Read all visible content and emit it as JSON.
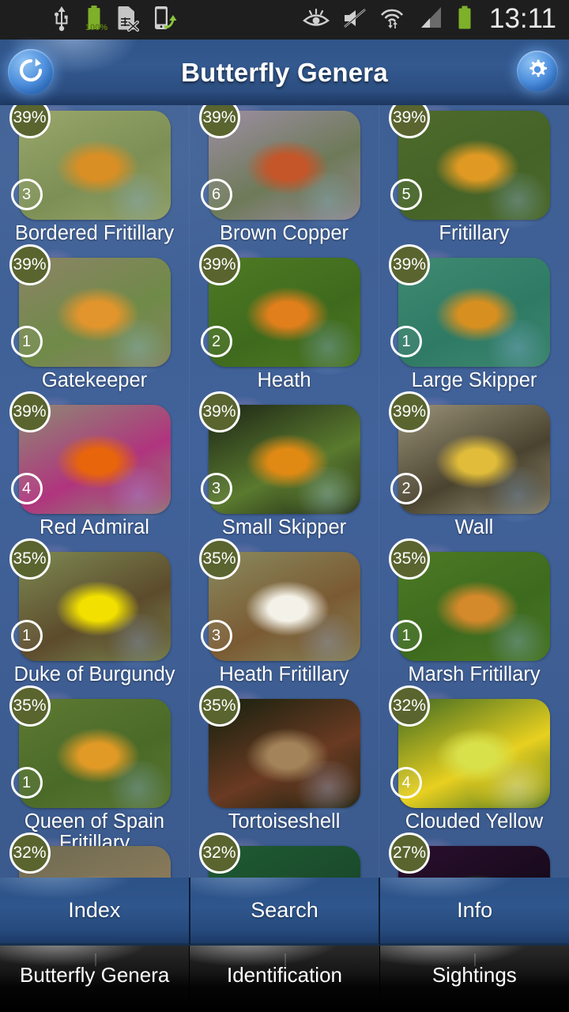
{
  "status_bar": {
    "time": "13:11",
    "battery_percent": "100%",
    "icons": [
      "usb-icon",
      "battery-icon",
      "sim-card-disabled-icon",
      "phone-transfer-icon",
      "eye-care-icon",
      "mute-icon",
      "wifi-icon",
      "signal-icon",
      "battery-icon"
    ]
  },
  "title_bar": {
    "title": "Butterfly Genera",
    "refresh_label": "refresh-icon",
    "settings_label": "gear-icon"
  },
  "grid": {
    "items": [
      {
        "name": "Bordered Fritillary",
        "percent": "39%",
        "count": "3",
        "img_a": "#9aa76b",
        "img_b": "#d98f24",
        "img_c": "#7c8f55"
      },
      {
        "name": "Brown Copper",
        "percent": "39%",
        "count": "6",
        "img_a": "#9e8ea4",
        "img_b": "#c4562a",
        "img_c": "#6d7a58"
      },
      {
        "name": "Fritillary",
        "percent": "39%",
        "count": "5",
        "img_a": "#4e6b2c",
        "img_b": "#e09a23",
        "img_c": "#456327"
      },
      {
        "name": "Gatekeeper",
        "percent": "39%",
        "count": "1",
        "img_a": "#8c8466",
        "img_b": "#e2952c",
        "img_c": "#6f8a48"
      },
      {
        "name": "Heath",
        "percent": "39%",
        "count": "2",
        "img_a": "#4e7a24",
        "img_b": "#e07f1c",
        "img_c": "#3f6a1d"
      },
      {
        "name": "Large Skipper",
        "percent": "39%",
        "count": "1",
        "img_a": "#3f8a72",
        "img_b": "#d79020",
        "img_c": "#2f7a64"
      },
      {
        "name": "Red Admiral",
        "percent": "39%",
        "count": "4",
        "img_a": "#8d8a74",
        "img_b": "#e8650c",
        "img_c": "#b0347e"
      },
      {
        "name": "Small Skipper",
        "percent": "39%",
        "count": "3",
        "img_a": "#1c2516",
        "img_b": "#e08a14",
        "img_c": "#5a7a2e"
      },
      {
        "name": "Wall",
        "percent": "39%",
        "count": "2",
        "img_a": "#9a9279",
        "img_b": "#e0bc3a",
        "img_c": "#4a432f"
      },
      {
        "name": "Duke of Burgundy",
        "percent": "35%",
        "count": "1",
        "img_a": "#7d8a52",
        "img_b": "#f2e000",
        "img_c": "#5c4b2c"
      },
      {
        "name": "Heath Fritillary",
        "percent": "35%",
        "count": "3",
        "img_a": "#8a8a5e",
        "img_b": "#f4f2e8",
        "img_c": "#7a5a33"
      },
      {
        "name": "Marsh Fritillary",
        "percent": "35%",
        "count": "1",
        "img_a": "#4c7a24",
        "img_b": "#d4892b",
        "img_c": "#3d6a1e"
      },
      {
        "name": "Queen of Spain Fritillary",
        "percent": "35%",
        "count": "1",
        "img_a": "#5e7a33",
        "img_b": "#e09a25",
        "img_c": "#4a6a28"
      },
      {
        "name": "Tortoiseshell",
        "percent": "35%",
        "count": "",
        "img_a": "#14200e",
        "img_b": "#a3845a",
        "img_c": "#6a3a22"
      },
      {
        "name": "Clouded Yellow",
        "percent": "32%",
        "count": "4",
        "img_a": "#3f6a22",
        "img_b": "#d8e04a",
        "img_c": "#e8d020"
      },
      {
        "name": "",
        "percent": "32%",
        "count": "",
        "img_a": "#6d6a52",
        "img_b": "#c9b082",
        "img_c": "#8a7a5a"
      },
      {
        "name": "",
        "percent": "32%",
        "count": "",
        "img_a": "#1f5a33",
        "img_b": "#2e7a44",
        "img_c": "#1a4a2a"
      },
      {
        "name": "",
        "percent": "27%",
        "count": "",
        "img_a": "#2a0f2e",
        "img_b": "#3cb020",
        "img_c": "#180a1c"
      }
    ]
  },
  "mid_bar": {
    "buttons": [
      {
        "label": "Index"
      },
      {
        "label": "Search"
      },
      {
        "label": "Info"
      }
    ]
  },
  "tab_bar": {
    "tabs": [
      {
        "label": "Butterfly Genera"
      },
      {
        "label": "Identification"
      },
      {
        "label": "Sightings"
      }
    ]
  },
  "colors": {
    "title_blue": "#2f5489",
    "body_blue": "#3f5f93",
    "badge_olive": "#59642f",
    "status_black": "#1e1e1e",
    "battery_green": "#7eb02a"
  }
}
